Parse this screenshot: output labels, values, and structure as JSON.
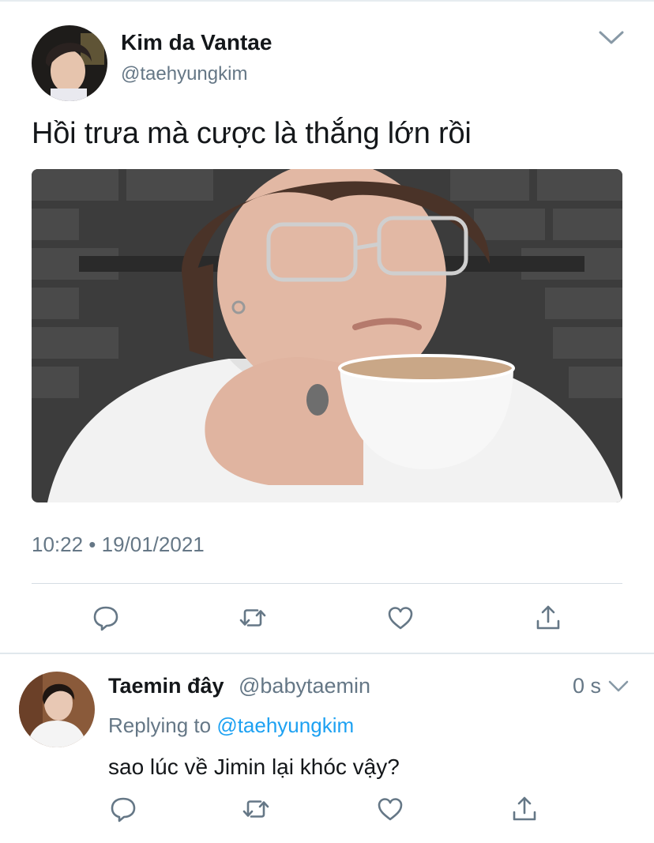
{
  "tweet": {
    "author": {
      "name": "Kim da Vantae",
      "handle": "@taehyungkim"
    },
    "text": "Hồi trưa mà cược là thắng lớn rồi",
    "timestamp": "10:22 • 19/01/2021",
    "actions": [
      {
        "icon": "reply-icon"
      },
      {
        "icon": "retweet-icon"
      },
      {
        "icon": "like-icon"
      },
      {
        "icon": "share-icon"
      }
    ],
    "menu_icon": "chevron-down-icon"
  },
  "reply": {
    "author": {
      "name": "Taemin đây",
      "handle": "@babytaemin"
    },
    "time": "0 s",
    "replying_prefix": "Replying to ",
    "replying_to": "@taehyungkim",
    "text": "sao lúc về Jimin lại khóc vậy?",
    "actions": [
      {
        "icon": "reply-icon"
      },
      {
        "icon": "retweet-icon"
      },
      {
        "icon": "like-icon"
      },
      {
        "icon": "share-icon"
      }
    ]
  },
  "colors": {
    "text": "#14171a",
    "secondary": "#657786",
    "link": "#1da1f2",
    "divider": "#e1e8ed"
  }
}
